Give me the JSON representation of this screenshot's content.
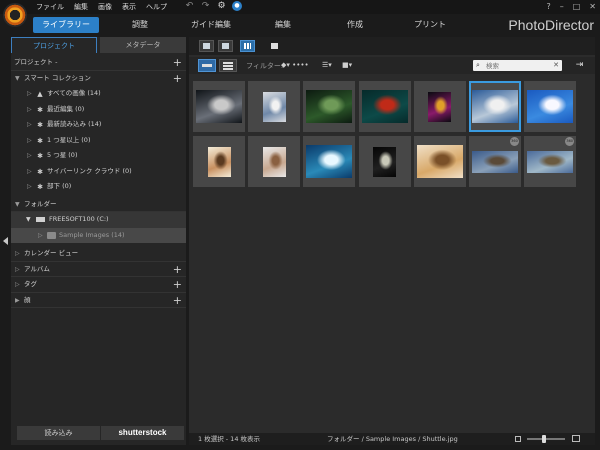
{
  "menu": {
    "items": [
      "ファイル",
      "編集",
      "画像",
      "表示",
      "ヘルプ"
    ]
  },
  "window": {
    "help": "?",
    "minimize": "–",
    "maximize": "□",
    "close": "✕"
  },
  "modules": [
    {
      "label": "ライブラリー",
      "active": true
    },
    {
      "label": "調整"
    },
    {
      "label": "ガイド編集"
    },
    {
      "label": "編集"
    },
    {
      "label": "作成"
    },
    {
      "label": "プリント"
    }
  ],
  "brand": "PhotoDirector",
  "left_panel": {
    "tabs": {
      "project": "プロジェクト",
      "metadata": "メタデータ"
    },
    "project_row": "プロジェクト - ",
    "smart_collection": "スマート コレクション",
    "smart_items": [
      {
        "label": "すべての画像 (14)",
        "icon": "images-icon"
      },
      {
        "label": "最近編集 (0)",
        "icon": "sparkle-icon"
      },
      {
        "label": "最新読み込み (14)",
        "icon": "sparkle-icon"
      },
      {
        "label": "1 つ星以上 (0)",
        "icon": "sparkle-icon"
      },
      {
        "label": "5 つ星 (0)",
        "icon": "sparkle-icon"
      },
      {
        "label": "サイバーリンク クラウド (0)",
        "icon": "sparkle-icon"
      },
      {
        "label": "部下 (0)",
        "icon": "sparkle-icon"
      }
    ],
    "folder": "フォルダー",
    "drive": "FREESOFT100 (C:)",
    "subfolder": "Sample Images (14)",
    "calendar": "カレンダー ビュー",
    "album": "アルバム",
    "tag": "タグ",
    "face": "顔",
    "import_button": "読み込み",
    "shutterstock_button": "shutterstock"
  },
  "toolbar": {
    "filter_label": "フィルター:",
    "search_placeholder": "検索"
  },
  "photos": [
    {
      "name": "spotlight-woman",
      "colors": [
        "#101418",
        "#6a6f78",
        "#c9c9c9"
      ],
      "orientation": "landscape"
    },
    {
      "name": "model-portrait",
      "colors": [
        "#d9dce0",
        "#6f88a8",
        "#f2f2f2"
      ],
      "orientation": "portrait"
    },
    {
      "name": "forest-path",
      "colors": [
        "#0c1a10",
        "#2d5a2a",
        "#6f9a58"
      ],
      "orientation": "landscape"
    },
    {
      "name": "red-leaf-water",
      "colors": [
        "#062a2a",
        "#0d4a48",
        "#c02a18"
      ],
      "orientation": "landscape"
    },
    {
      "name": "colorful-lights",
      "colors": [
        "#0a0a10",
        "#8a1a6a",
        "#e0a028"
      ],
      "orientation": "portrait"
    },
    {
      "name": "shuttle-launch",
      "colors": [
        "#2a5a98",
        "#b8c8d8",
        "#f0f0f0"
      ],
      "orientation": "landscape",
      "selected": true
    },
    {
      "name": "jumping-man",
      "colors": [
        "#1a5ac0",
        "#3a8ae0",
        "#f8f8ff"
      ],
      "orientation": "landscape"
    },
    {
      "name": "woman-smile",
      "colors": [
        "#f4ecd8",
        "#c89060",
        "#5a3a20"
      ],
      "orientation": "portrait"
    },
    {
      "name": "child-portrait",
      "colors": [
        "#e8e8e8",
        "#c8a890",
        "#8a6040"
      ],
      "orientation": "portrait"
    },
    {
      "name": "ocean-wave",
      "colors": [
        "#0a3a6a",
        "#2a8ab8",
        "#e8f8ff"
      ],
      "orientation": "landscape"
    },
    {
      "name": "dark-figure",
      "colors": [
        "#050505",
        "#202020",
        "#c8c8b8"
      ],
      "orientation": "portrait"
    },
    {
      "name": "woman-lying",
      "colors": [
        "#f0e0c8",
        "#d8a868",
        "#7a5028"
      ],
      "orientation": "landscape"
    },
    {
      "name": "panorama-360-a",
      "colors": [
        "#3a5a8a",
        "#8aa0b8",
        "#5a4a38"
      ],
      "orientation": "panorama",
      "badge": "360"
    },
    {
      "name": "panorama-360-b",
      "colors": [
        "#4a6a9a",
        "#a0b8c8",
        "#6a5a40"
      ],
      "orientation": "panorama",
      "badge": "360"
    }
  ],
  "status": {
    "selection": "1 枚選択 - 14 枚表示",
    "path": "フォルダー / Sample Images / Shuttle.jpg",
    "zoom_fraction": 0.45
  },
  "colors": {
    "accent": "#2c80c8",
    "selection_border": "#3a9be0"
  }
}
